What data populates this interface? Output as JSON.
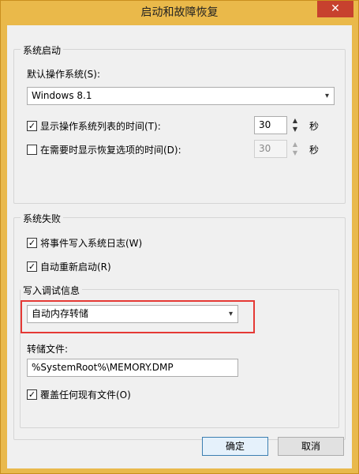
{
  "window": {
    "title": "启动和故障恢复",
    "close_glyph": "✕"
  },
  "system_startup": {
    "group_label": "系统启动",
    "default_os_label": "默认操作系统(S):",
    "default_os_value": "Windows 8.1",
    "show_os_list_label": "显示操作系统列表的时间(T):",
    "show_os_list_checked": true,
    "show_os_list_value": "30",
    "show_recovery_label": "在需要时显示恢复选项的时间(D):",
    "show_recovery_checked": false,
    "show_recovery_value": "30",
    "seconds_unit": "秒"
  },
  "system_failure": {
    "group_label": "系统失败",
    "write_event_label": "将事件写入系统日志(W)",
    "write_event_checked": true,
    "auto_restart_label": "自动重新启动(R)",
    "auto_restart_checked": true
  },
  "debug_info": {
    "group_label": "写入调试信息",
    "dump_type_value": "自动内存转储",
    "dump_file_label": "转储文件:",
    "dump_file_value": "%SystemRoot%\\MEMORY.DMP",
    "overwrite_label": "覆盖任何现有文件(O)",
    "overwrite_checked": true
  },
  "buttons": {
    "ok": "确定",
    "cancel": "取消"
  },
  "icons": {
    "check": "✓",
    "dropdown": "▾",
    "up": "▲",
    "down": "▼"
  }
}
